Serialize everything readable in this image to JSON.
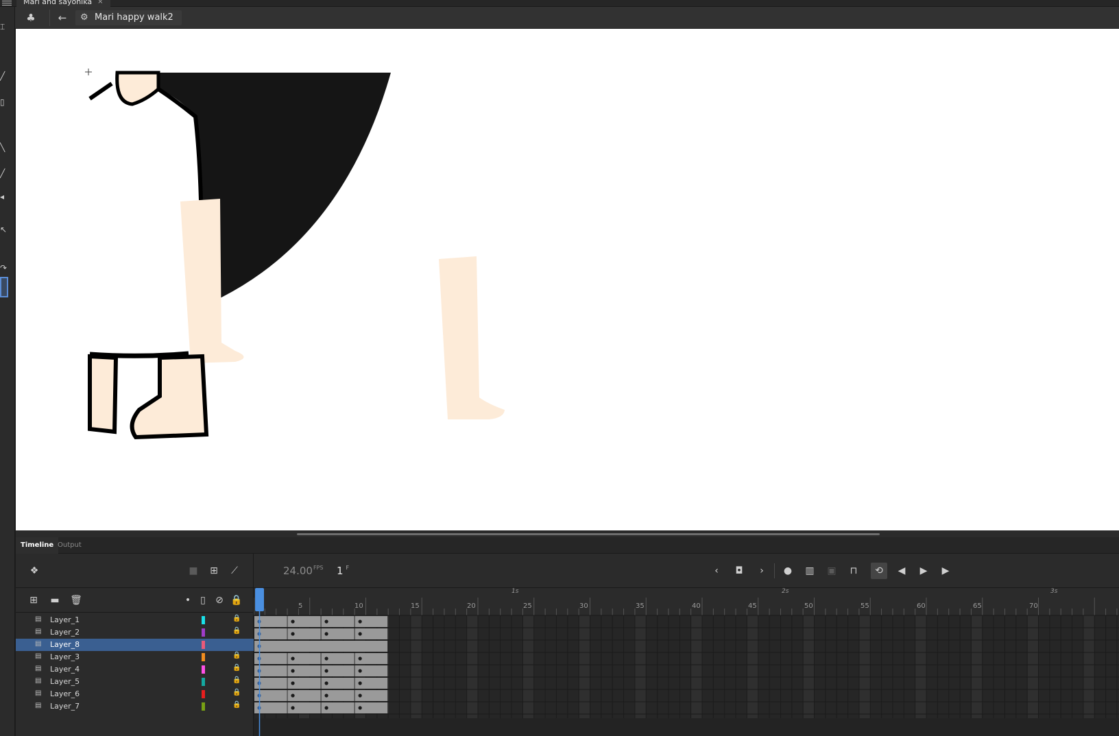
{
  "document": {
    "tab_title": "Mari and sayonika",
    "close_glyph": "×"
  },
  "editbar": {
    "scene_name": "Mari happy walk2"
  },
  "panel_tabs": [
    "Timeline",
    "Output"
  ],
  "timeline": {
    "fps": "24.00",
    "fps_unit": "FPS",
    "current_frame": "1",
    "frame_unit": "F",
    "frame_ruler": [
      "5",
      "10",
      "15",
      "20",
      "25",
      "30",
      "35",
      "40",
      "45",
      "50",
      "55",
      "60",
      "65",
      "70"
    ],
    "second_markers": [
      "1s",
      "2s",
      "3s"
    ]
  },
  "layers": [
    {
      "name": "Layer_1",
      "color": "#19e0e8",
      "locked": true,
      "selected": false
    },
    {
      "name": "Layer_2",
      "color": "#a03cc8",
      "locked": true,
      "selected": false
    },
    {
      "name": "Layer_8",
      "color": "#e85a7a",
      "locked": false,
      "selected": true
    },
    {
      "name": "Layer_3",
      "color": "#f08c1e",
      "locked": true,
      "selected": false
    },
    {
      "name": "Layer_4",
      "color": "#ff50e6",
      "locked": true,
      "selected": false
    },
    {
      "name": "Layer_5",
      "color": "#14a8a0",
      "locked": true,
      "selected": false
    },
    {
      "name": "Layer_6",
      "color": "#e81e1e",
      "locked": true,
      "selected": false
    },
    {
      "name": "Layer_7",
      "color": "#78a014",
      "locked": true,
      "selected": false
    }
  ],
  "colors": {
    "accent": "#4a8fe0",
    "selection": "#3a5f91",
    "skin": "#fdebd8",
    "ink": "#151515"
  }
}
